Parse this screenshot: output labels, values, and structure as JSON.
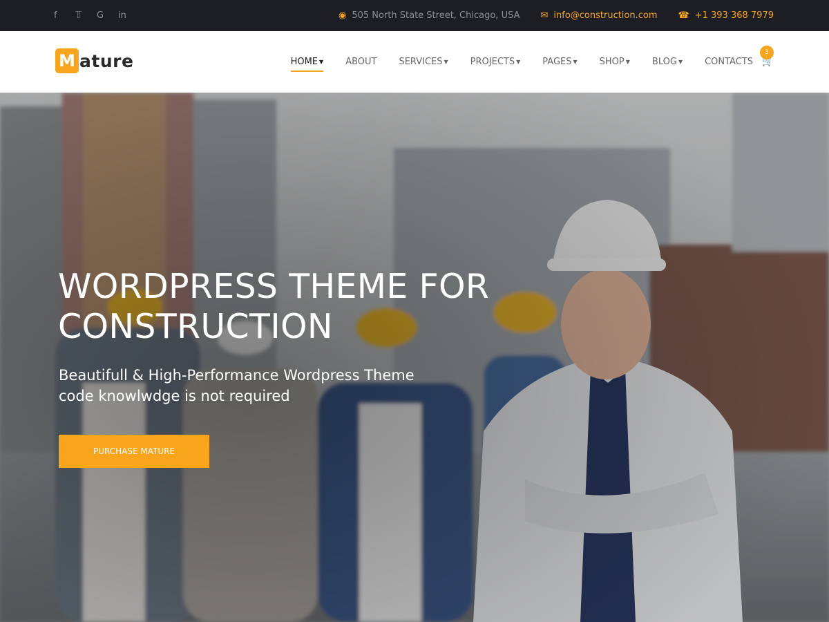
{
  "topbar": {
    "social": [
      {
        "icon": "facebook-icon",
        "glyph": "f"
      },
      {
        "icon": "twitter-icon",
        "glyph": "♥"
      },
      {
        "icon": "google-icon",
        "glyph": "G"
      },
      {
        "icon": "linkedin-icon",
        "glyph": "in"
      }
    ],
    "address": "505 North State Street, Chicago, USA",
    "email": "info@construction.com",
    "phone": "+1 393 368 7979"
  },
  "header": {
    "logo_letter": "M",
    "logo_rest": "ature",
    "nav": [
      {
        "label": "HOME",
        "caret": true,
        "active": true
      },
      {
        "label": "ABOUT",
        "caret": false,
        "active": false
      },
      {
        "label": "SERVICES",
        "caret": true,
        "active": false
      },
      {
        "label": "PROJECTS",
        "caret": true,
        "active": false
      },
      {
        "label": "PAGES",
        "caret": true,
        "active": false
      },
      {
        "label": "SHOP",
        "caret": true,
        "active": false
      },
      {
        "label": "BLOG",
        "caret": true,
        "active": false
      },
      {
        "label": "CONTACTS",
        "caret": false,
        "active": false
      }
    ],
    "cart_count": "3"
  },
  "hero": {
    "title_line1": "WORDPRESS THEME FOR",
    "title_line2": "CONSTRUCTION",
    "subtitle_line1": "Beautifull & High-Performance Wordpress Theme",
    "subtitle_line2": "code knowlwdge is not required",
    "button": "PURCHASE MATURE"
  },
  "colors": {
    "accent": "#f8a51c",
    "topbar_bg": "#1d1e23",
    "header_bg": "#ffffff"
  }
}
